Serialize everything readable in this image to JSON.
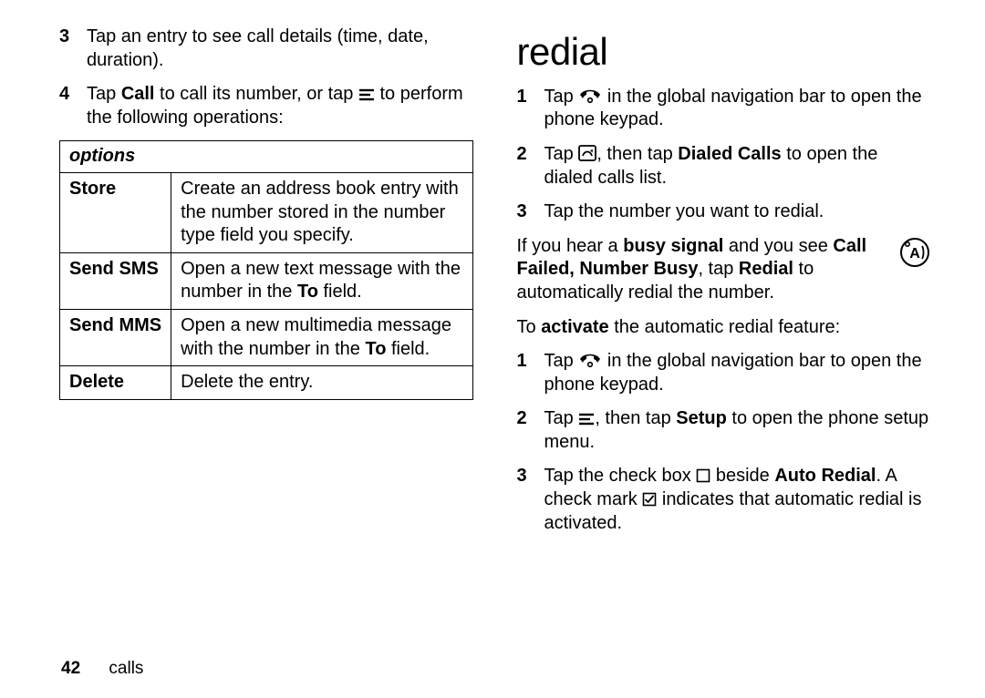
{
  "left": {
    "steps": [
      {
        "num": "3",
        "text": "Tap an entry to see call details (time, date, duration)."
      },
      {
        "num": "4",
        "parts": [
          {
            "t": "Tap "
          },
          {
            "t": "Call",
            "cls": "cond"
          },
          {
            "t": " to call its number, or tap "
          },
          {
            "icon": "menu-icon"
          },
          {
            "t": " to perform the following operations:"
          }
        ]
      }
    ],
    "options_header": "options",
    "options": [
      {
        "k": "Store",
        "v": [
          {
            "t": "Create an address book entry with the number stored in the number type field you specify."
          }
        ]
      },
      {
        "k": "Send SMS",
        "v": [
          {
            "t": "Open a new text message with the number in the "
          },
          {
            "t": "To",
            "cls": "cond"
          },
          {
            "t": " field."
          }
        ]
      },
      {
        "k": "Send MMS",
        "v": [
          {
            "t": "Open a new multimedia message with the number in the "
          },
          {
            "t": "To",
            "cls": "cond"
          },
          {
            "t": " field."
          }
        ]
      },
      {
        "k": "Delete",
        "v": [
          {
            "t": "Delete the entry."
          }
        ]
      }
    ]
  },
  "right": {
    "heading": "redial",
    "steps_a": [
      {
        "num": "1",
        "parts": [
          {
            "t": "Tap "
          },
          {
            "icon": "phone-icon"
          },
          {
            "t": " in the global navigation bar to open the phone keypad."
          }
        ]
      },
      {
        "num": "2",
        "parts": [
          {
            "t": "Tap "
          },
          {
            "icon": "recent-calls-icon"
          },
          {
            "t": ", then tap "
          },
          {
            "t": "Dialed Calls",
            "cls": "cond"
          },
          {
            "t": " to open the dialed calls list."
          }
        ]
      },
      {
        "num": "3",
        "parts": [
          {
            "t": "Tap the number you want to redial."
          }
        ]
      }
    ],
    "busy_para": [
      {
        "t": "If you hear a "
      },
      {
        "t": "busy signal",
        "cls": "bold"
      },
      {
        "t": " and you see "
      },
      {
        "t": "Call Failed, Number Busy",
        "cls": "cond"
      },
      {
        "t": ", tap "
      },
      {
        "t": "Redial",
        "cls": "cond"
      },
      {
        "t": " to automatically redial the number."
      }
    ],
    "busy_side_icon": "feature-icon",
    "activate_para": [
      {
        "t": "To "
      },
      {
        "t": "activate",
        "cls": "bold"
      },
      {
        "t": " the automatic redial feature:"
      }
    ],
    "steps_b": [
      {
        "num": "1",
        "parts": [
          {
            "t": "Tap "
          },
          {
            "icon": "phone-icon"
          },
          {
            "t": " in the global navigation bar to open the phone keypad."
          }
        ]
      },
      {
        "num": "2",
        "parts": [
          {
            "t": "Tap "
          },
          {
            "icon": "menu-icon"
          },
          {
            "t": ", then tap "
          },
          {
            "t": "Setup",
            "cls": "cond"
          },
          {
            "t": " to open the phone setup menu."
          }
        ]
      },
      {
        "num": "3",
        "parts": [
          {
            "t": "Tap the check box "
          },
          {
            "icon": "checkbox-empty-icon"
          },
          {
            "t": " beside "
          },
          {
            "t": "Auto Redial",
            "cls": "cond"
          },
          {
            "t": ". A check mark "
          },
          {
            "icon": "checkbox-checked-icon"
          },
          {
            "t": " indicates that automatic redial is activated."
          }
        ]
      }
    ]
  },
  "footer": {
    "page": "42",
    "section": "calls"
  }
}
